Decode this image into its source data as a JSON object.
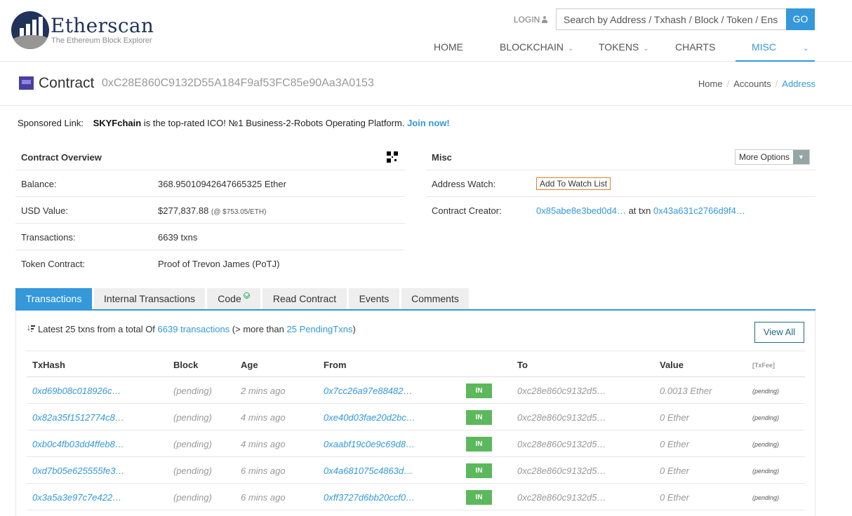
{
  "brand": {
    "name": "Etherscan",
    "tagline": "The Ethereum Block Explorer"
  },
  "header": {
    "login_label": "LOGIN",
    "search_placeholder": "Search by Address / Txhash / Block / Token / Ens",
    "go_label": "GO",
    "nav": [
      {
        "label": "HOME"
      },
      {
        "label": "BLOCKCHAIN",
        "has_dropdown": true
      },
      {
        "label": "TOKENS",
        "has_dropdown": true
      },
      {
        "label": "CHARTS"
      },
      {
        "label": "MISC",
        "has_dropdown": true,
        "active": true
      }
    ]
  },
  "page": {
    "title": "Contract",
    "address": "0xC28E860C9132D55A184F9af53FC85e90Aa3A0153",
    "breadcrumb": [
      "Home",
      "Accounts",
      "Address"
    ]
  },
  "sponsored": {
    "label": "Sponsored Link:",
    "name": "SKYFchain",
    "text": "is the top-rated ICO! №1 Business-2-Robots Operating Platform.",
    "cta": "Join now!"
  },
  "overview": {
    "title": "Contract Overview",
    "rows": [
      {
        "label": "Balance:",
        "value": "368.95010942647665325 Ether"
      },
      {
        "label": "USD Value:",
        "value": "$277,837.88",
        "note": "(@ $753.05/ETH)"
      },
      {
        "label": "Transactions:",
        "value": "6639 txns"
      },
      {
        "label": "Token Contract:",
        "value": "Proof of Trevon James (PoTJ)"
      }
    ]
  },
  "misc": {
    "title": "Misc",
    "more_options_label": "More Options",
    "address_watch_label": "Address Watch:",
    "watch_button": "Add To Watch List",
    "creator_label": "Contract Creator:",
    "creator_address": "0x85abe8e3bed0d4…",
    "creator_at_txn": "at txn",
    "creator_txn": "0x43a631c2766d9f4…"
  },
  "tabs": [
    {
      "label": "Transactions",
      "active": true
    },
    {
      "label": "Internal Transactions"
    },
    {
      "label": "Code",
      "verified": true
    },
    {
      "label": "Read Contract"
    },
    {
      "label": "Events"
    },
    {
      "label": "Comments"
    }
  ],
  "transactions": {
    "summary_prefix": "Latest 25 txns from a total Of",
    "total_link": "6639 transactions",
    "summary_middle": "(> more than",
    "pending_link": "25 PendingTxns",
    "summary_suffix": ")",
    "view_all_label": "View All",
    "columns": [
      "TxHash",
      "Block",
      "Age",
      "From",
      "",
      "To",
      "Value",
      "[TxFee]"
    ],
    "direction_label": "IN",
    "rows": [
      {
        "hash": "0xd69b08c018926c…",
        "block": "(pending)",
        "age": "2 mins ago",
        "from": "0x7cc26a97e88482…",
        "to": "0xc28e860c9132d5…",
        "value": "0.0013 Ether",
        "fee": "(pending)"
      },
      {
        "hash": "0x82a35f1512774c8…",
        "block": "(pending)",
        "age": "4 mins ago",
        "from": "0xe40d03fae20d2bc…",
        "to": "0xc28e860c9132d5…",
        "value": "0 Ether",
        "fee": "(pending)"
      },
      {
        "hash": "0xb0c4fb03dd4ffeb8…",
        "block": "(pending)",
        "age": "4 mins ago",
        "from": "0xaabf19c0e9c69d8…",
        "to": "0xc28e860c9132d5…",
        "value": "0 Ether",
        "fee": "(pending)"
      },
      {
        "hash": "0xd7b05e625555fe3…",
        "block": "(pending)",
        "age": "6 mins ago",
        "from": "0x4a681075c4863d…",
        "to": "0xc28e860c9132d5…",
        "value": "0 Ether",
        "fee": "(pending)"
      },
      {
        "hash": "0x3a5a3e97c7e422…",
        "block": "(pending)",
        "age": "6 mins ago",
        "from": "0xff3727d6bb20ccf0…",
        "to": "0xc28e860c9132d5…",
        "value": "0 Ether",
        "fee": "(pending)"
      }
    ]
  },
  "colors": {
    "accent": "#3498db",
    "brand": "#21325b",
    "in_badge": "#5cb85c",
    "watch_border": "#e67e22"
  },
  "icons": [
    "logo-mark-icon",
    "person-icon",
    "contract-icon",
    "qr-code-icon",
    "caret-down-icon",
    "check-circle-icon",
    "sort-icon"
  ]
}
